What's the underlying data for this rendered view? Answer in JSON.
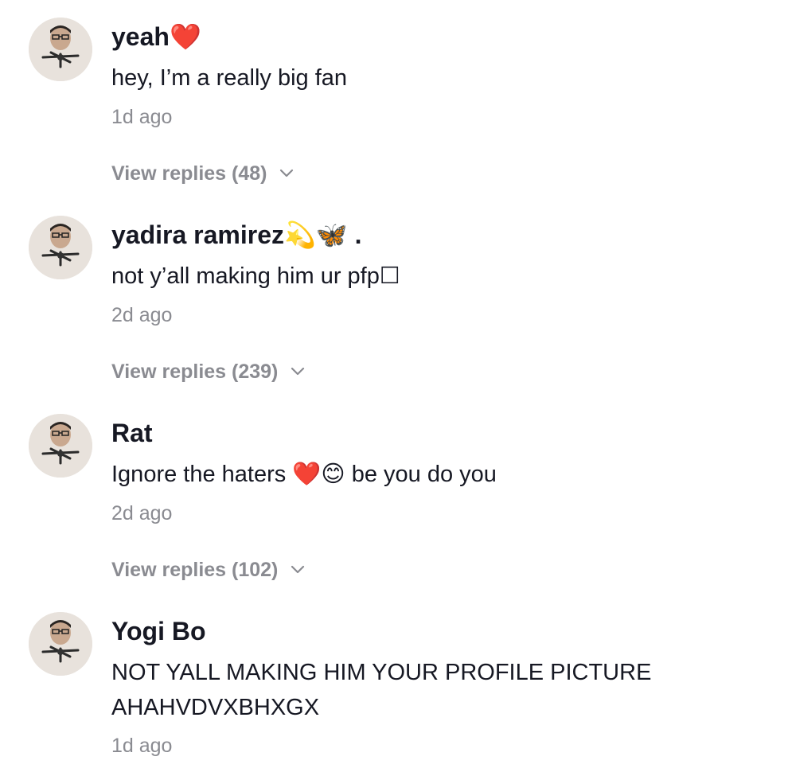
{
  "comments": [
    {
      "username": "yeah❤️",
      "text": "hey, I’m a really big fan",
      "time": "1d ago",
      "replies": "View replies (48)"
    },
    {
      "username": "yadira ramirez💫🦋 .",
      "text": "not y’all making him ur pfp☐",
      "time": "2d ago",
      "replies": "View replies (239)"
    },
    {
      "username": "Rat",
      "text": "Ignore the haters ❤️😊 be you do you",
      "time": "2d ago",
      "replies": "View replies (102)"
    },
    {
      "username": "Yogi Bo",
      "text": "NOT YALL MAKING HIM YOUR PROFILE PICTURE\nAHAHVDVXBHXGX",
      "time": "1d ago"
    }
  ],
  "icons": {
    "avatar": "profile-photo",
    "expand": "chevron-down-icon"
  },
  "colors": {
    "primary_text": "#161823",
    "secondary_text": "#8a8b91",
    "background": "#ffffff"
  }
}
